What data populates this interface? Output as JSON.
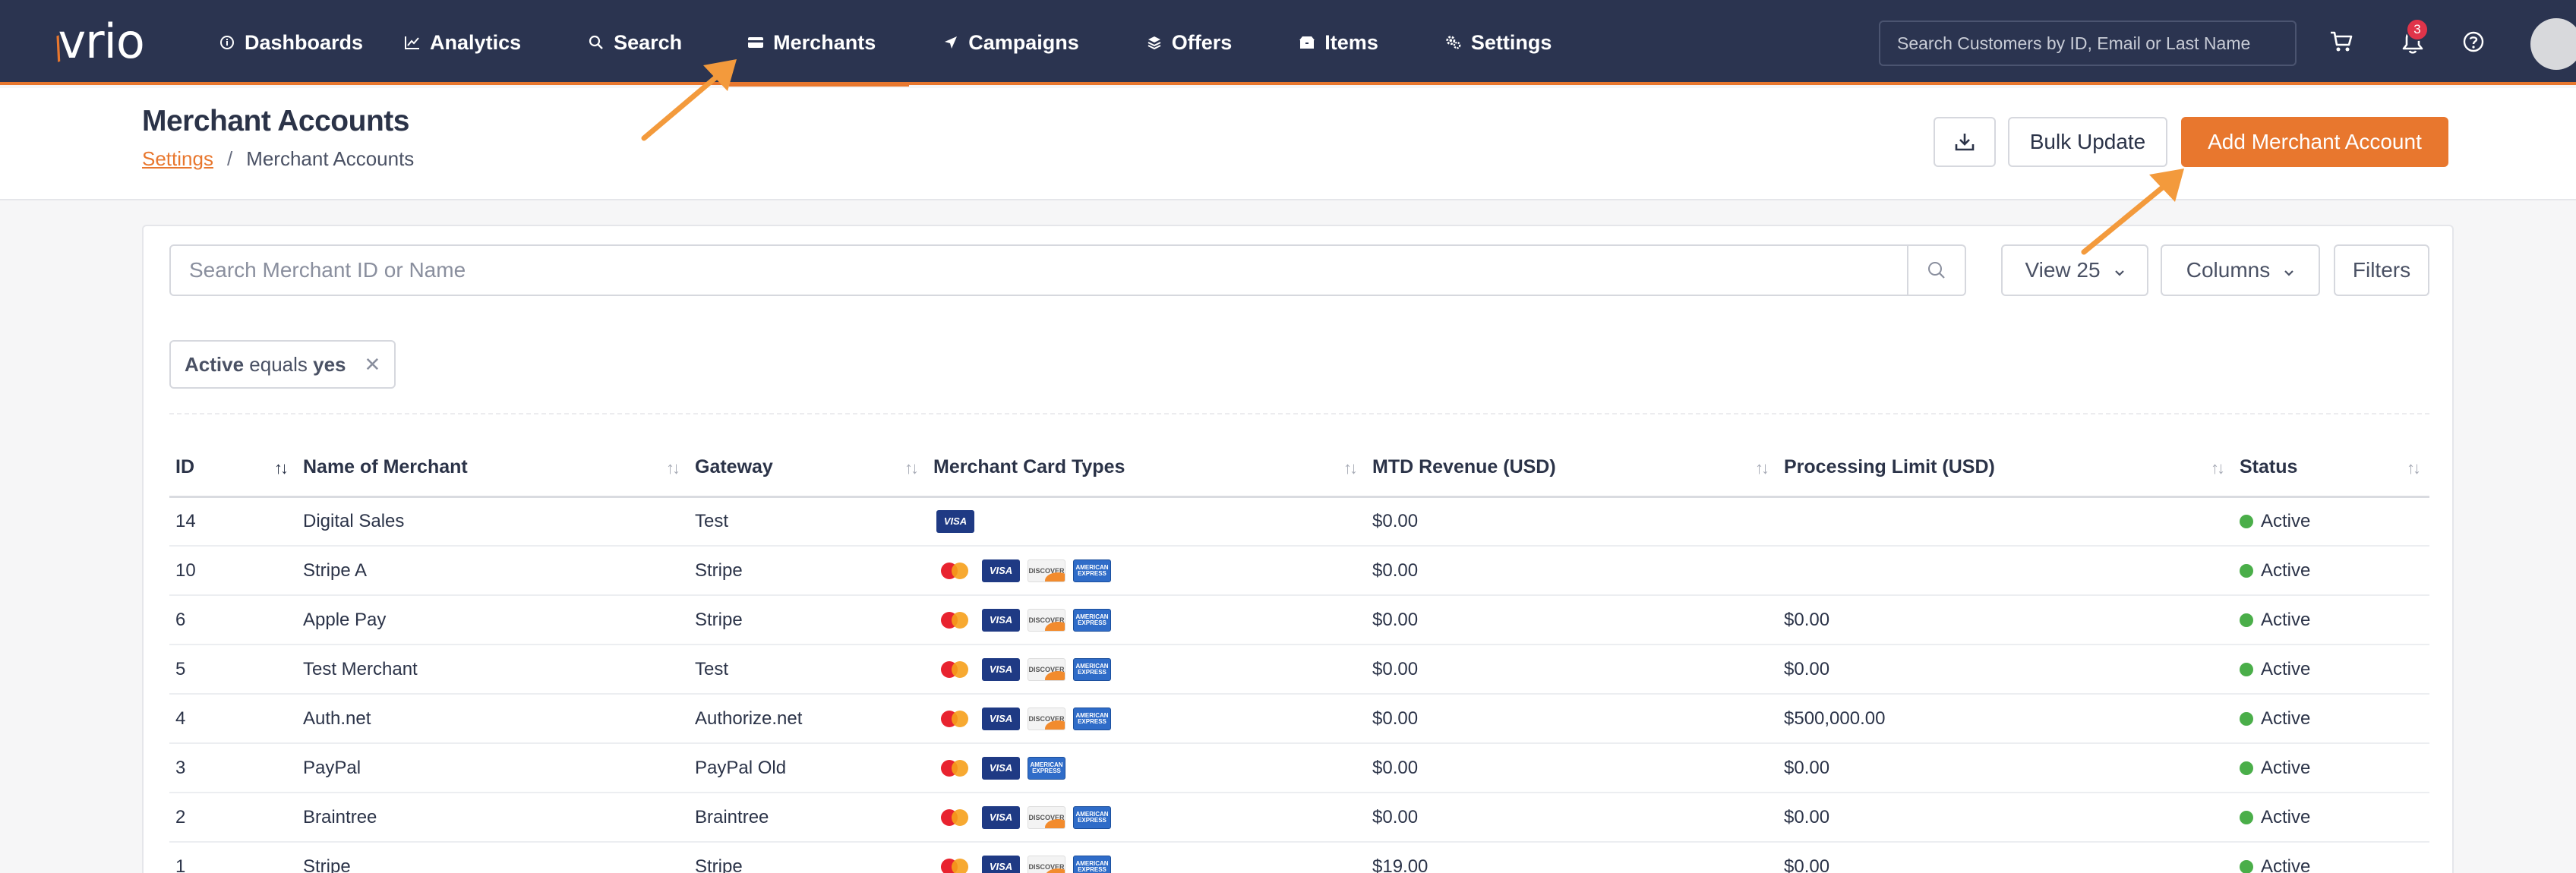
{
  "nav": {
    "logo": "vrio",
    "items": [
      {
        "label": "Dashboards",
        "icon": "info-circle-icon"
      },
      {
        "label": "Analytics",
        "icon": "line-chart-icon"
      },
      {
        "label": "Search",
        "icon": "search-icon"
      },
      {
        "label": "Merchants",
        "icon": "wallet-icon"
      },
      {
        "label": "Campaigns",
        "icon": "paper-plane-icon"
      },
      {
        "label": "Offers",
        "icon": "layers-icon"
      },
      {
        "label": "Items",
        "icon": "box-icon"
      },
      {
        "label": "Settings",
        "icon": "gears-icon"
      }
    ],
    "search_placeholder": "Search Customers by ID, Email or Last Name",
    "notification_count": "3"
  },
  "header": {
    "title": "Merchant Accounts",
    "breadcrumb_link": "Settings",
    "breadcrumb_separator": "/",
    "breadcrumb_current": "Merchant Accounts",
    "bulk_update_label": "Bulk Update",
    "add_label": "Add Merchant Account"
  },
  "toolbar": {
    "search_placeholder": "Search Merchant ID or Name",
    "view_label": "View 25",
    "columns_label": "Columns",
    "filters_label": "Filters"
  },
  "filter_chip": {
    "field": "Active",
    "op": "equals",
    "value": "yes"
  },
  "table": {
    "columns": [
      "ID",
      "Name of Merchant",
      "Gateway",
      "Merchant Card Types",
      "MTD Revenue (USD)",
      "Processing Limit (USD)",
      "Status"
    ],
    "rows": [
      {
        "id": "14",
        "name": "Digital Sales",
        "gateway": "Test",
        "cards": [
          "visa"
        ],
        "revenue": "$0.00",
        "limit": "",
        "status": "Active"
      },
      {
        "id": "10",
        "name": "Stripe A",
        "gateway": "Stripe",
        "cards": [
          "mastercard",
          "visa",
          "discover",
          "amex"
        ],
        "revenue": "$0.00",
        "limit": "",
        "status": "Active"
      },
      {
        "id": "6",
        "name": "Apple Pay",
        "gateway": "Stripe",
        "cards": [
          "mastercard",
          "visa",
          "discover",
          "amex"
        ],
        "revenue": "$0.00",
        "limit": "$0.00",
        "status": "Active"
      },
      {
        "id": "5",
        "name": "Test Merchant",
        "gateway": "Test",
        "cards": [
          "mastercard",
          "visa",
          "discover",
          "amex"
        ],
        "revenue": "$0.00",
        "limit": "$0.00",
        "status": "Active"
      },
      {
        "id": "4",
        "name": "Auth.net",
        "gateway": "Authorize.net",
        "cards": [
          "mastercard",
          "visa",
          "discover",
          "amex"
        ],
        "revenue": "$0.00",
        "limit": "$500,000.00",
        "status": "Active"
      },
      {
        "id": "3",
        "name": "PayPal",
        "gateway": "PayPal Old",
        "cards": [
          "mastercard",
          "visa",
          "amex"
        ],
        "revenue": "$0.00",
        "limit": "$0.00",
        "status": "Active"
      },
      {
        "id": "2",
        "name": "Braintree",
        "gateway": "Braintree",
        "cards": [
          "mastercard",
          "visa",
          "discover",
          "amex"
        ],
        "revenue": "$0.00",
        "limit": "$0.00",
        "status": "Active"
      },
      {
        "id": "1",
        "name": "Stripe",
        "gateway": "Stripe",
        "cards": [
          "mastercard",
          "visa",
          "discover",
          "amex"
        ],
        "revenue": "$19.00",
        "limit": "$0.00",
        "status": "Active"
      }
    ]
  },
  "colors": {
    "nav_bg": "#2b3450",
    "accent": "#e8772e",
    "status_active": "#4aae49",
    "annotation_arrow": "#f39a3c"
  }
}
